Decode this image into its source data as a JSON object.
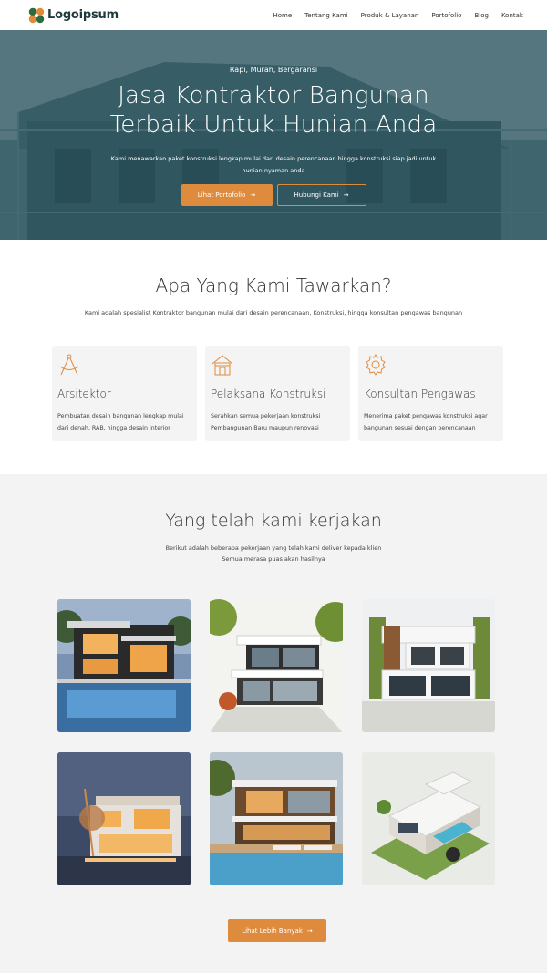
{
  "brand": {
    "name": "Logoipsum",
    "accent": "#df8b3e",
    "dark": "#1f3a3a"
  },
  "nav": {
    "items": [
      "Home",
      "Tentang Kami",
      "Produk & Layanan",
      "Portofolio",
      "Blog",
      "Kontak"
    ]
  },
  "hero": {
    "tagline": "Rapi, Murah, Bergaransi",
    "title_line1": "Jasa Kontraktor Bangunan",
    "title_line2": "Terbaik Untuk Hunian Anda",
    "description": "Kami menawarkan paket konstruksi lengkap mulai dari desain perencanaan hingga konstruksi siap jadi untuk hunian nyaman anda",
    "primary_button": "Lihat Portofolio",
    "secondary_button": "Hubungi Kami",
    "arrow": "→"
  },
  "offer": {
    "title": "Apa Yang Kami Tawarkan?",
    "subtitle": "Kami adalah spesialist Kontraktor bangunan mulai dari desain perencanaan, Konstruksi, hingga konsultan pengawas bangunan",
    "cards": [
      {
        "icon": "compass-icon",
        "title": "Arsitektor",
        "desc": "Pembuatan desain bangunan lengkap mulai dari denah, RAB, hingga desain interior"
      },
      {
        "icon": "house-icon",
        "title": "Pelaksana Konstruksi",
        "desc": "Serahkan semua pekerjaan konstruksi Pembangunan Baru maupun renovasi"
      },
      {
        "icon": "gear-icon",
        "title": "Konsultan Pengawas",
        "desc": "Menerima paket pengawas konstruksi agar bangunan sesuai dengan perencanaan"
      }
    ]
  },
  "work": {
    "title": "Yang telah kami kerjakan",
    "subtitle_line1": "Berikut adalah beberapa pekerjaan yang telah kami deliver kepada klien",
    "subtitle_line2": "Semua merasa puas akan hasilnya",
    "button": "Lihat Lebih Banyak",
    "arrow": "→"
  }
}
